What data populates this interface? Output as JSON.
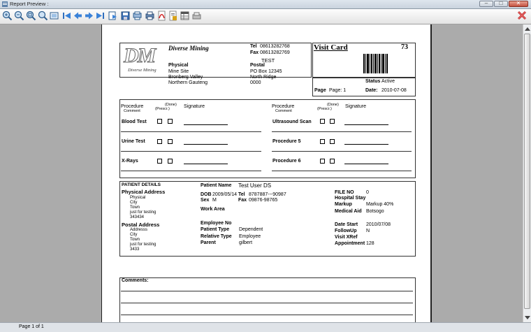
{
  "window": {
    "title": "Report Preview :"
  },
  "toolbar": {
    "buttons": [
      "zoom-in",
      "zoom-out",
      "zoom-fit",
      "zoom-width",
      "fit-page",
      "first-page",
      "previous-page",
      "next-page",
      "last-page",
      "go-to-page",
      "save",
      "print-setup",
      "print",
      "export-pdf",
      "export-word",
      "export-excel",
      "send"
    ]
  },
  "status": {
    "page": "Page 1 of 1"
  },
  "report": {
    "logo_letters": "DM",
    "logo_text": "Diverse Mining",
    "company": "Diverse Mining",
    "tel_label": "Tel",
    "tel": "08613282768",
    "fax_label": "Fax",
    "fax": "08613282769",
    "test": "TEST",
    "physical_label": "Physical",
    "postal_label": "Postal",
    "physical": [
      "Mine Site",
      "Bronberg Valley",
      "Northern Gauteng"
    ],
    "postal": [
      "PO Box 12345",
      "North Ridge",
      "0000"
    ],
    "visit_card_title": "Visit Card",
    "visit_number": "73",
    "status_label": "Status",
    "status_value": "Active",
    "page_label": "Page",
    "page_value": "Page: 1",
    "date_label": "Date:",
    "date_value": "2010-07-08",
    "proc_header": {
      "procedure": "Procedure",
      "comment": "Comment",
      "done": "(Done)",
      "prescr": "(Prescr.)",
      "signature": "Signature"
    },
    "procedures_left": [
      "Blood Test",
      "Urine Test",
      "X-Rays"
    ],
    "procedures_right": [
      "Ultrasound Scan",
      "Procedure 5",
      "Procedure 6"
    ],
    "patient": {
      "section_title": "PATIENT DETAILS",
      "physical_address_label": "Physical Address",
      "physical_address": [
        "Physical",
        "City",
        "Town",
        "just for testing",
        "343434"
      ],
      "postal_address_label": "Postal Address",
      "postal_address": [
        "Addresss",
        "City",
        "Town",
        "just for testing",
        "3433"
      ],
      "name_label": "Patient Name",
      "name": "Test User DS",
      "dob_label": "DOB",
      "dob": "2009/05/14",
      "sex_label": "Sex",
      "sex": "M",
      "tel_label": "Tel",
      "tel": "8787887---90987",
      "fax_label": "Fax",
      "fax": "09876-98765",
      "work_area_label": "Work Area",
      "employee_no_label": "Employee No",
      "patient_type_label": "Patient Type",
      "patient_type": "Dependent",
      "relative_type_label": "Relative Type",
      "relative_type": "Employee",
      "parent_label": "Parent",
      "parent": "gilbert",
      "file_no_label": "FILE NO",
      "file_no": "0",
      "hospital_stay_label": "Hospital Stay",
      "markup_label": "Markup",
      "markup": "Markup 40%",
      "medical_aid_label": "Medical Aid",
      "medical_aid": "Botsogo",
      "date_start_label": "Date Start",
      "date_start": "2010/07/08",
      "followup_label": "FollowUp",
      "followup": "N",
      "visit_xref_label": "Visit XRef",
      "appointment_label": "Appointment",
      "appointment": "128"
    },
    "comments_label": "Comments:"
  }
}
